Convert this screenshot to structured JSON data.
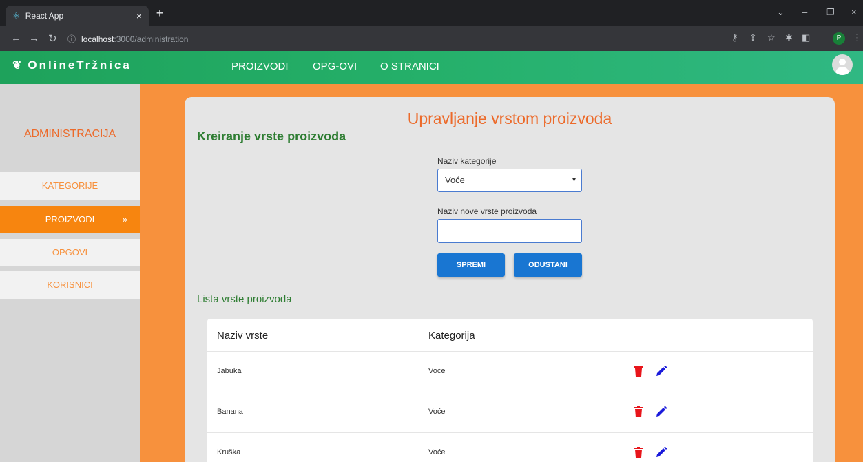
{
  "browser": {
    "tab_title": "React App",
    "url_host": "localhost",
    "url_rest": ":3000/administration",
    "profile_initial": "P"
  },
  "navbar": {
    "brand": "OnlineTržnica",
    "links": [
      "PROIZVODI",
      "OPG-OVI",
      "O STRANICI"
    ]
  },
  "sidebar": {
    "title": "ADMINISTRACIJA",
    "items": [
      {
        "label": "KATEGORIJE",
        "active": false
      },
      {
        "label": "PROIZVODI",
        "active": true
      },
      {
        "label": "OPGOVI",
        "active": false
      },
      {
        "label": "KORISNICI",
        "active": false
      }
    ],
    "active_chevron": "»"
  },
  "main": {
    "page_title": "Upravljanje vrstom proizvoda",
    "section_title": "Kreiranje vrste proizvoda",
    "category_label": "Naziv kategorije",
    "category_value": "Voće",
    "new_type_label": "Naziv nove vrste proizvoda",
    "new_type_value": "",
    "save_label": "SPREMI",
    "cancel_label": "ODUSTANI",
    "list_title": "Lista vrste proizvoda"
  },
  "table": {
    "headers": [
      "Naziv vrste",
      "Kategorija"
    ],
    "rows": [
      {
        "name": "Jabuka",
        "category": "Voće"
      },
      {
        "name": "Banana",
        "category": "Voće"
      },
      {
        "name": "Kruška",
        "category": "Voće"
      }
    ]
  },
  "colors": {
    "accent_orange": "#f7913d",
    "title_orange": "#ec6a2a",
    "green": "#2e7d32",
    "button_blue": "#1976d2",
    "delete_red": "#e8151b",
    "edit_blue": "#1a1adb"
  }
}
